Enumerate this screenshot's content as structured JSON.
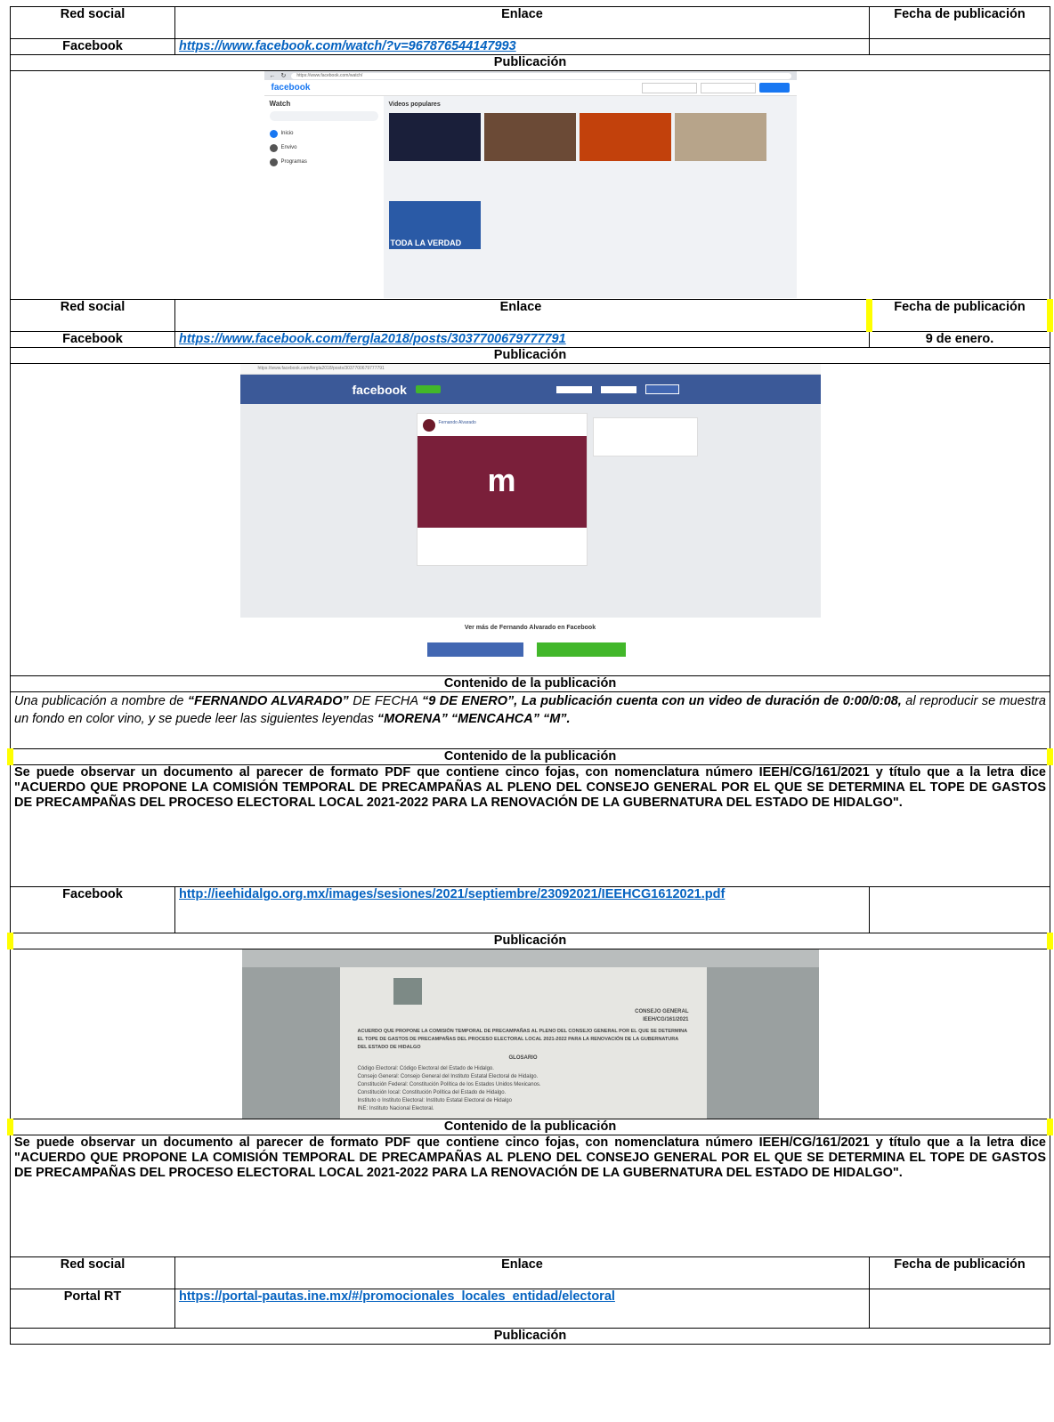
{
  "headers": {
    "red_social": "Red social",
    "enlace": "Enlace",
    "fecha": "Fecha de publicación"
  },
  "labels": {
    "publicacion": "Publicación",
    "contenido": "Contenido de la publicación"
  },
  "rows": [
    {
      "red": "Facebook",
      "enlace": "https://www.facebook.com/watch/?v=967876544147993",
      "fecha": ""
    },
    {
      "red": "Facebook",
      "enlace": "https://www.facebook.com/fergla2018/posts/3037700679777791",
      "fecha": "9 de enero."
    },
    {
      "red": "Facebook",
      "enlace": "http://ieehidalgo.org.mx/images/sesiones/2021/septiembre/23092021/IEEHCG1612021.pdf",
      "fecha": ""
    },
    {
      "red": "Portal RT",
      "enlace": "https://portal-pautas.ine.mx/#/promocionales_locales_entidad/electoral",
      "fecha": ""
    }
  ],
  "contenido_1": {
    "p1": "Una publicación a nombre de ",
    "b1": "“FERNANDO ALVARADO”",
    "p2": " DE FECHA ",
    "b2": "“9 DE ENERO”, La publicación cuenta con un video de duración de 0:00/0:08,",
    "p3": " al reproducir se muestra un fondo en color vino, y se puede leer las siguientes leyendas ",
    "b3": "“MORENA” “MENCAHCA” “M”."
  },
  "contenido_pdf": "Se puede observar un documento al parecer de formato PDF que contiene cinco fojas, con nomenclatura número IEEH/CG/161/2021 y título que a la letra dice \"ACUERDO QUE PROPONE LA COMISIÓN TEMPORAL DE PRECAMPAÑAS AL PLENO DEL CONSEJO GENERAL POR EL QUE SE DETERMINA EL TOPE DE GASTOS DE PRECAMPAÑAS DEL PROCESO ELECTORAL LOCAL 2021-2022 PARA LA RENOVACIÓN DE LA GUBERNATURA DEL ESTADO DE HIDALGO\".",
  "shot1": {
    "url": "https://www.facebook.com/watch/",
    "logo": "facebook",
    "side_title": "Watch",
    "side_items": [
      "Inicio",
      "Envivo",
      "Programas"
    ],
    "section": "Videos populares",
    "thumb_colors": [
      "#1a1f3a",
      "#6b4a36",
      "#c2410c",
      "#b7a48a",
      "#8c8c8c",
      "#2a5aa6"
    ],
    "banner": "TODA LA VERDAD"
  },
  "shot2": {
    "url": "https://www.facebook.com/fergla2018/posts/3037700679777791",
    "logo": "facebook",
    "author": "Fernando Alvarado",
    "video_letter": "m",
    "footer": "Ver más de Fernando Alvarado en Facebook",
    "video_color": "#7a1f3a"
  },
  "shot3": {
    "header": "CONSEJO GENERAL",
    "code": "IEEH/CG/161/2021",
    "title": "ACUERDO QUE PROPONE LA COMISIÓN TEMPORAL DE PRECAMPAÑAS AL PLENO DEL CONSEJO GENERAL POR EL QUE SE DETERMINA EL TOPE DE GASTOS DE PRECAMPAÑAS DEL PROCESO ELECTORAL LOCAL 2021-2022 PARA LA RENOVACIÓN DE LA GUBERNATURA DEL ESTADO DE HIDALGO",
    "glosario": "GLOSARIO",
    "items": [
      "Código Electoral: Código Electoral del Estado de Hidalgo.",
      "Consejo General: Consejo General del Instituto Estatal Electoral de Hidalgo.",
      "Constitución Federal: Constitución Política de los Estados Unidos Mexicanos.",
      "Constitución local: Constitución Política del Estado de Hidalgo.",
      "Instituto o Instituto Electoral: Instituto Estatal Electoral de Hidalgo",
      "INE: Instituto Nacional Electoral."
    ]
  },
  "colors": {
    "link": "#0563c1",
    "highlight": "#ffff00"
  }
}
